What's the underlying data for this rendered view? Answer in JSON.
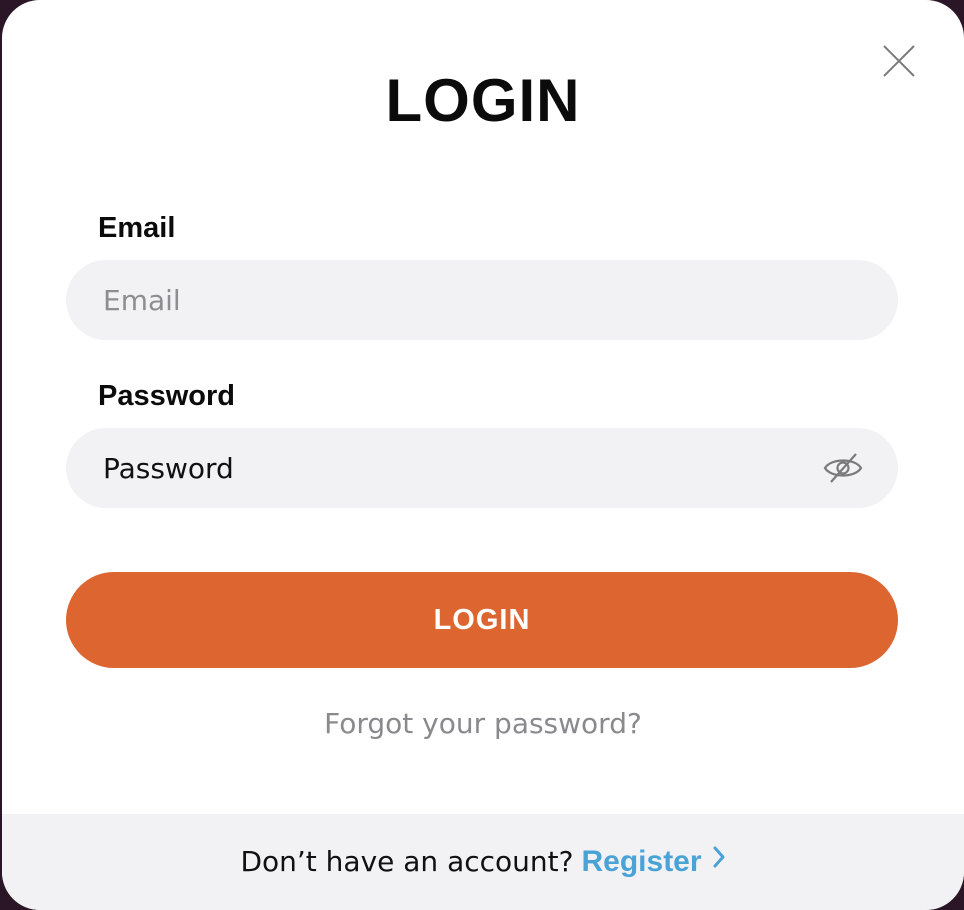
{
  "modal": {
    "title": "LOGIN",
    "email": {
      "label": "Email",
      "placeholder": "Email",
      "value": ""
    },
    "password": {
      "label": "Password",
      "placeholder": "Password",
      "value": ""
    },
    "login_button": "LOGIN",
    "forgot_link": "Forgot your password?",
    "footer": {
      "prompt": "Don’t have an account?",
      "register_link": "Register"
    }
  },
  "icons": {
    "close": "close-icon",
    "eye": "eye-slash-icon",
    "chevron": "chevron-right-icon"
  },
  "colors": {
    "accent": "#dc6530",
    "link": "#4aa3d6",
    "input_bg": "#f2f2f4"
  }
}
